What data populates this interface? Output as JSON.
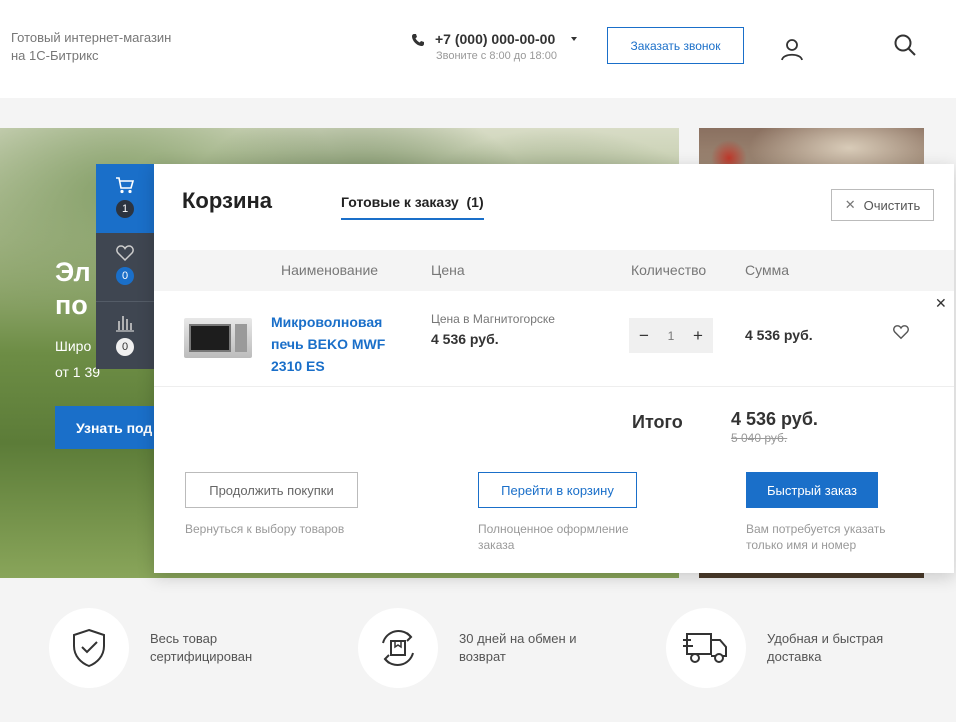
{
  "header": {
    "logo_line1": "Готовый интернет-магазин",
    "logo_line2": "на 1С-Битрикс",
    "phone": "+7 (000) 000-00-00",
    "phone_hours": "Звоните с 8:00 до 18:00",
    "callback_label": "Заказать звонок"
  },
  "hero": {
    "title_line1": "Эл",
    "title_line2": "по",
    "sub_line1": "Широ",
    "sub_line2": "от 1 39",
    "button_label": "Узнать под"
  },
  "sidepanel": {
    "cart_count": "1",
    "favorites_count": "0",
    "compare_count": "0"
  },
  "cart": {
    "title": "Корзина",
    "tab_label": "Готовые к заказу",
    "tab_count": "(1)",
    "clear_label": "Очистить",
    "columns": [
      "Наименование",
      "Цена",
      "Количество",
      "Сумма"
    ],
    "item": {
      "name": "Микроволновая печь BEKO MWF 2310 ES",
      "price_city": "Цена в Магнитогорске",
      "price": "4 536 руб.",
      "quantity": "1",
      "sum": "4 536 руб."
    },
    "total_label": "Итого",
    "total_value": "4 536 руб.",
    "total_old": "5 040 руб.",
    "actions": {
      "continue_label": "Продолжить покупки",
      "continue_hint": "Вернуться к выбору товаров",
      "cart_label": "Перейти в корзину",
      "cart_hint_line1": "Полноценное оформление",
      "cart_hint_line2": "заказа",
      "fast_label": "Быстрый заказ",
      "fast_hint_line1": "Вам потребуется указать",
      "fast_hint_line2": "только имя и номер"
    }
  },
  "features": [
    {
      "icon": "shield-check-icon",
      "line1": "Весь товар",
      "line2": "сертифицирован"
    },
    {
      "icon": "exchange-box-icon",
      "line1": "30 дней на обмен и",
      "line2": "возврат"
    },
    {
      "icon": "delivery-truck-icon",
      "line1": "Удобная и быстрая",
      "line2": "доставка"
    }
  ],
  "colors": {
    "accent": "#1a6fc9",
    "sidepanel": "#3f4651"
  }
}
